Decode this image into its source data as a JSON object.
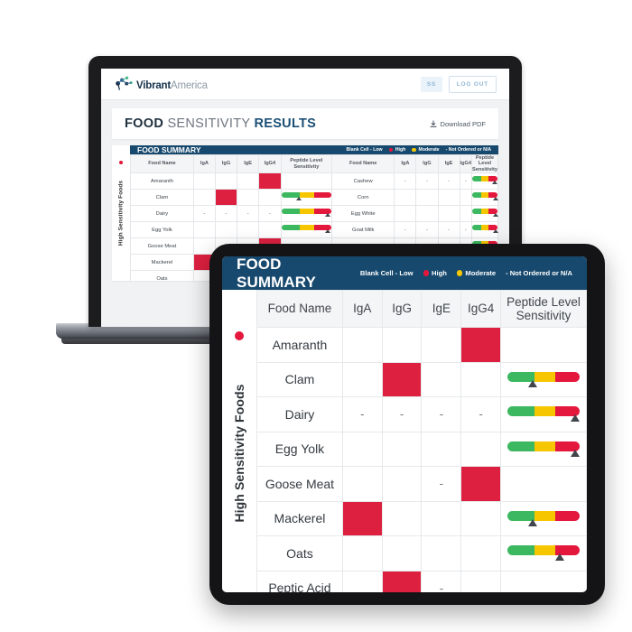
{
  "app": {
    "logo": {
      "brand_bold": "Vibrant",
      "brand_light": "America",
      "icon": "molecule-logo-icon"
    },
    "user_badge": "SS",
    "logout_label": "LOG OUT",
    "page_title": {
      "part1": "FOOD",
      "part2": "SENSITIVITY",
      "part3": "RESULTS"
    },
    "download_label": "Download PDF",
    "download_icon": "download-icon"
  },
  "summary": {
    "title": "FOOD SUMMARY",
    "legend": [
      {
        "label": "Blank Cell - Low",
        "dot": null
      },
      {
        "label": "High",
        "dot": "#e4173c"
      },
      {
        "label": "Moderate",
        "dot": "#f6c700"
      },
      {
        "label": "- Not Ordered or N/A",
        "dot": null
      }
    ],
    "side_label": "High Sensitivity Foods",
    "side_dot_color": "#e4173c",
    "columns": [
      "Food Name",
      "IgA",
      "IgG",
      "IgE",
      "IgG4",
      "Peptide Level Sensitivity"
    ],
    "peptide_header_line1": "Peptide Level",
    "peptide_header_line2": "Sensitivity"
  },
  "colors": {
    "header_blue": "#17496e",
    "high_red": "#dd2040",
    "moderate_yellow": "#f6c700",
    "low_green": "#3cb860",
    "title_accent": "#1b4f76"
  },
  "tablet_rows": [
    {
      "food": "Amaranth",
      "IgA": "",
      "IgG": "",
      "IgE": "",
      "IgG4": "high",
      "bar": null
    },
    {
      "food": "Clam",
      "IgA": "",
      "IgG": "high",
      "IgE": "",
      "IgG4": "",
      "bar": 35
    },
    {
      "food": "Dairy",
      "IgA": "-",
      "IgG": "-",
      "IgE": "-",
      "IgG4": "-",
      "bar": 94
    },
    {
      "food": "Egg Yolk",
      "IgA": "",
      "IgG": "",
      "IgE": "",
      "IgG4": "",
      "bar": 94
    },
    {
      "food": "Goose Meat",
      "IgA": "",
      "IgG": "",
      "IgE": "-",
      "IgG4": "high",
      "bar": null
    },
    {
      "food": "Mackerel",
      "IgA": "high",
      "IgG": "",
      "IgE": "",
      "IgG4": "",
      "bar": 35
    },
    {
      "food": "Oats",
      "IgA": "",
      "IgG": "",
      "IgE": "",
      "IgG4": "",
      "bar": 72
    },
    {
      "food": "Peptic Acid",
      "IgA": "",
      "IgG": "high",
      "IgE": "-",
      "IgG4": "",
      "bar": null
    }
  ],
  "laptop_rows_left": [
    {
      "food": "Amaranth",
      "IgA": "",
      "IgG": "",
      "IgE": "",
      "IgG4": "high",
      "bar": null
    },
    {
      "food": "Clam",
      "IgA": "",
      "IgG": "high",
      "IgE": "",
      "IgG4": "",
      "bar": 35
    },
    {
      "food": "Dairy",
      "IgA": "-",
      "IgG": "-",
      "IgE": "-",
      "IgG4": "-",
      "bar": 92
    },
    {
      "food": "Egg Yolk",
      "IgA": "",
      "IgG": "",
      "IgE": "",
      "IgG4": "",
      "bar": 92
    },
    {
      "food": "Goose Meat",
      "IgA": "",
      "IgG": "",
      "IgE": "",
      "IgG4": "high",
      "bar": null
    },
    {
      "food": "Mackerel",
      "IgA": "high",
      "IgG": "",
      "IgE": "",
      "IgG4": "",
      "bar": null
    },
    {
      "food": "Oats",
      "IgA": "",
      "IgG": "",
      "IgE": "",
      "IgG4": "",
      "bar": null
    },
    {
      "food": "Peptic Acid",
      "IgA": "",
      "IgG": "high",
      "IgE": "",
      "IgG4": "",
      "bar": null
    }
  ],
  "laptop_rows_right": [
    {
      "food": "Cashew",
      "IgA": "-",
      "IgG": "-",
      "IgE": "-",
      "IgG4": "-",
      "bar": 88
    },
    {
      "food": "Corn",
      "IgA": "",
      "IgG": "",
      "IgE": "",
      "IgG4": "",
      "bar": 94
    },
    {
      "food": "Egg White",
      "IgA": "",
      "IgG": "",
      "IgE": "",
      "IgG4": "",
      "bar": 94
    },
    {
      "food": "Goat Milk",
      "IgA": "-",
      "IgG": "-",
      "IgE": "-",
      "IgG4": "-",
      "bar": 94
    },
    {
      "food": "",
      "IgA": "",
      "IgG": "",
      "IgE": "",
      "IgG4": "",
      "bar": 90
    }
  ]
}
